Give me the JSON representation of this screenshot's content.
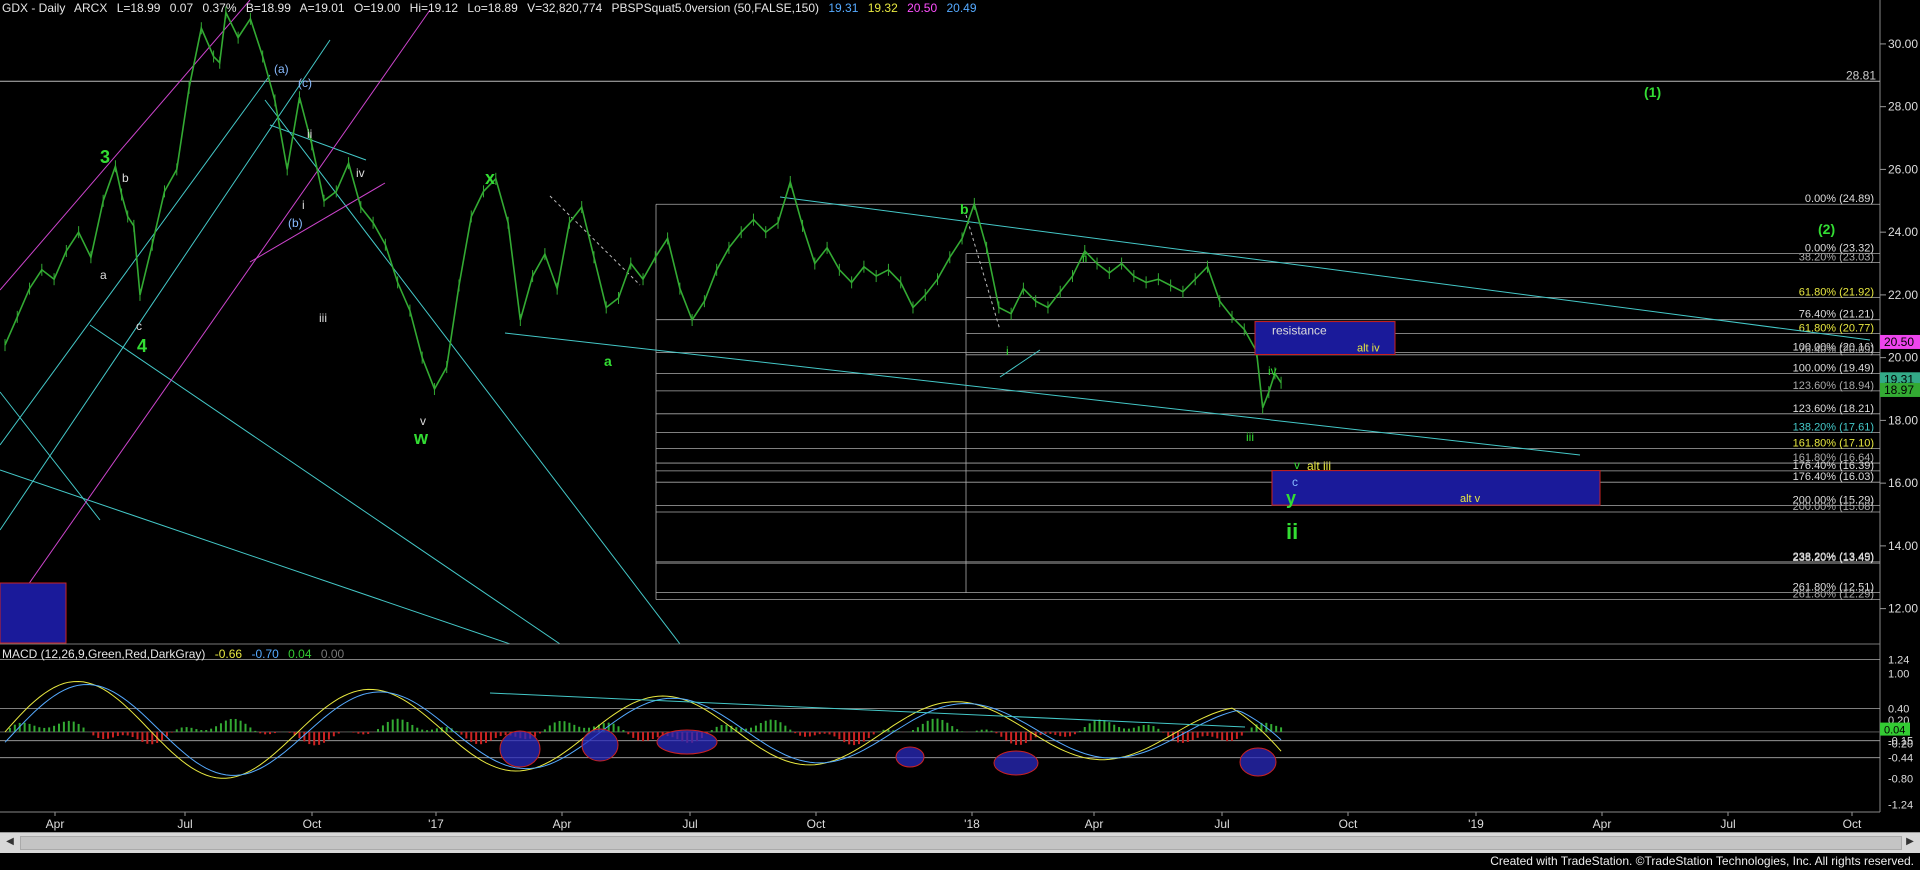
{
  "header": {
    "symbol": "GDX - Daily",
    "exchange": "ARCX",
    "last": "L=18.99",
    "change": "0.07",
    "change_pct": "0.37%",
    "bid": "B=18.99",
    "ask": "A=19.01",
    "open": "O=19.00",
    "high": "Hi=19.12",
    "low": "Lo=18.89",
    "volume": "V=32,820,774",
    "indicator": "PBSPSquat5.0version (50,FALSE,150)",
    "ind_values": [
      "19.31",
      "19.32",
      "20.50",
      "20.49"
    ],
    "ind_colors": [
      "#55aaff",
      "#e8e840",
      "#ff4fff",
      "#55aaff"
    ]
  },
  "macd_header": {
    "label": "MACD (12,26,9,Green,Red,DarkGray)",
    "values": [
      "-0.66",
      "-0.70",
      "0.04",
      "0.00"
    ],
    "colors": [
      "#e8e840",
      "#55aaff",
      "#33cc33",
      "#777777"
    ]
  },
  "footer": "Created with TradeStation. ©TradeStation Technologies, Inc. All rights reserved.",
  "colors": {
    "price": "#33aa33",
    "channel_cyan": "#44c8c8",
    "channel_magenta": "#cc44cc",
    "grid_white": "#bbbbbb",
    "box_fill": "#1a1a9a",
    "box_border": "#cc2222",
    "wave_green": "#33dd33",
    "wave_yellow": "#e8e840",
    "wave_blue": "#88bbff",
    "label_white": "#dddddd"
  },
  "chart_data": {
    "type": "line",
    "title": "GDX - Daily",
    "x_ticks": [
      "Apr",
      "Jul",
      "Oct",
      "'17",
      "Apr",
      "Jul",
      "Oct",
      "'18",
      "Apr",
      "Jul",
      "Oct",
      "'19",
      "Apr",
      "Jul",
      "Oct"
    ],
    "y_ticks": [
      "30.00",
      "28.00",
      "26.00",
      "24.00",
      "22.00",
      "20.00",
      "18.00",
      "16.00",
      "14.00",
      "12.00"
    ],
    "ylim": [
      11,
      31.4
    ],
    "series": [
      {
        "values": [
          [
            0,
            20.4
          ],
          [
            10,
            21.3
          ],
          [
            20,
            22.2
          ],
          [
            30,
            22.8
          ],
          [
            40,
            22.5
          ],
          [
            50,
            23.4
          ],
          [
            60,
            24.0
          ],
          [
            70,
            23.2
          ],
          [
            80,
            25.0
          ],
          [
            90,
            26.1
          ],
          [
            95,
            25.2
          ],
          [
            100,
            24.5
          ],
          [
            105,
            24.2
          ],
          [
            110,
            22.0
          ],
          [
            120,
            23.6
          ],
          [
            130,
            25.3
          ],
          [
            140,
            26.0
          ],
          [
            150,
            28.6
          ],
          [
            160,
            30.5
          ],
          [
            170,
            29.6
          ],
          [
            175,
            29.4
          ],
          [
            180,
            31.0
          ],
          [
            190,
            30.2
          ],
          [
            200,
            30.8
          ],
          [
            210,
            29.6
          ],
          [
            220,
            28.2
          ],
          [
            230,
            26.0
          ],
          [
            240,
            28.3
          ],
          [
            250,
            26.8
          ],
          [
            260,
            25.0
          ],
          [
            270,
            25.3
          ],
          [
            280,
            26.2
          ],
          [
            290,
            24.8
          ],
          [
            300,
            24.3
          ],
          [
            310,
            23.6
          ],
          [
            320,
            22.4
          ],
          [
            330,
            21.5
          ],
          [
            340,
            20.0
          ],
          [
            350,
            19.0
          ],
          [
            360,
            19.7
          ],
          [
            370,
            22.3
          ],
          [
            380,
            24.5
          ],
          [
            390,
            25.3
          ],
          [
            400,
            25.7
          ],
          [
            410,
            24.3
          ],
          [
            420,
            21.2
          ],
          [
            430,
            22.6
          ],
          [
            440,
            23.3
          ],
          [
            450,
            22.2
          ],
          [
            460,
            24.3
          ],
          [
            470,
            24.8
          ],
          [
            480,
            23.2
          ],
          [
            490,
            21.6
          ],
          [
            500,
            21.9
          ],
          [
            510,
            23.0
          ],
          [
            520,
            22.5
          ],
          [
            530,
            23.2
          ],
          [
            540,
            23.8
          ],
          [
            550,
            22.2
          ],
          [
            560,
            21.2
          ],
          [
            570,
            21.8
          ],
          [
            580,
            22.8
          ],
          [
            590,
            23.5
          ],
          [
            600,
            24.0
          ],
          [
            610,
            24.4
          ],
          [
            620,
            24.0
          ],
          [
            630,
            24.3
          ],
          [
            640,
            25.6
          ],
          [
            650,
            24.2
          ],
          [
            660,
            23.0
          ],
          [
            670,
            23.5
          ],
          [
            680,
            22.8
          ],
          [
            690,
            22.4
          ],
          [
            700,
            22.9
          ],
          [
            710,
            22.6
          ],
          [
            720,
            22.8
          ],
          [
            730,
            22.4
          ],
          [
            740,
            21.6
          ],
          [
            750,
            22.0
          ],
          [
            760,
            22.5
          ],
          [
            770,
            23.2
          ],
          [
            780,
            23.8
          ],
          [
            790,
            24.9
          ],
          [
            800,
            23.5
          ],
          [
            810,
            21.6
          ],
          [
            820,
            21.4
          ],
          [
            830,
            22.2
          ],
          [
            840,
            21.8
          ],
          [
            850,
            21.6
          ],
          [
            860,
            22.1
          ],
          [
            870,
            22.6
          ],
          [
            880,
            23.4
          ],
          [
            890,
            23.0
          ],
          [
            900,
            22.7
          ],
          [
            910,
            23.0
          ],
          [
            920,
            22.6
          ],
          [
            930,
            22.4
          ],
          [
            940,
            22.5
          ],
          [
            950,
            22.3
          ],
          [
            960,
            22.1
          ],
          [
            970,
            22.5
          ],
          [
            980,
            22.9
          ],
          [
            990,
            21.8
          ],
          [
            1000,
            21.3
          ],
          [
            1010,
            20.9
          ],
          [
            1020,
            20.2
          ],
          [
            1025,
            18.4
          ],
          [
            1030,
            18.9
          ],
          [
            1035,
            19.5
          ],
          [
            1040,
            19.2
          ]
        ]
      }
    ],
    "price_tags": [
      {
        "value": "28.81",
        "color": "#cccccc"
      },
      {
        "value": "20.50",
        "color": "#ee44ee"
      },
      {
        "value": "19.31",
        "color": "#33aa88"
      },
      {
        "value": "18.97",
        "color": "#33aa33"
      }
    ],
    "fib_levels_left": [
      {
        "text": "0.00% (24.89)"
      },
      {
        "text": "0.00% (23.32)"
      },
      {
        "text": "38.20% (23.03)"
      },
      {
        "text": "61.80% (21.92)"
      },
      {
        "text": "76.40% (21.21)"
      },
      {
        "text": "61.80% (20.77)"
      },
      {
        "text": "100.00% (20.16)"
      },
      {
        "text": "76.40% (20.09)"
      },
      {
        "text": "100.00% (19.49)"
      },
      {
        "text": "123.60% (18.94)"
      },
      {
        "text": "123.60% (18.21)"
      },
      {
        "text": "138.20% (17.61)"
      },
      {
        "text": "161.80% (17.10)"
      },
      {
        "text": "161.80% (16.64)"
      },
      {
        "text": "176.40% (16.39)"
      },
      {
        "text": "176.40% (16.03)"
      },
      {
        "text": "200.00% (15.29)"
      },
      {
        "text": "200.00% (15.08)"
      },
      {
        "text": "238.20% (13.49)"
      },
      {
        "text": "238.20% (13.45)"
      },
      {
        "text": "261.80% (12.51)"
      },
      {
        "text": "261.80% (12.29)"
      }
    ],
    "wave_labels": [
      {
        "text": "3"
      },
      {
        "text": "4"
      },
      {
        "text": "b"
      },
      {
        "text": "a"
      },
      {
        "text": "c"
      },
      {
        "text": "(a)"
      },
      {
        "text": "(c)"
      },
      {
        "text": "(b)"
      },
      {
        "text": "ii"
      },
      {
        "text": "i"
      },
      {
        "text": "iii"
      },
      {
        "text": "iv"
      },
      {
        "text": "v"
      },
      {
        "text": "w"
      },
      {
        "text": "x"
      },
      {
        "text": "a"
      },
      {
        "text": "b"
      },
      {
        "text": "i"
      },
      {
        "text": "ii"
      },
      {
        "text": "iii"
      },
      {
        "text": "iv"
      },
      {
        "text": "v"
      },
      {
        "text": "alt iii"
      },
      {
        "text": "c"
      },
      {
        "text": "y"
      },
      {
        "text": "ii"
      },
      {
        "text": "(1)"
      },
      {
        "text": "(2)"
      }
    ],
    "boxes": [
      {
        "text": "resistance",
        "sub": "alt iv"
      },
      {
        "text": "",
        "sub": "alt v"
      }
    ],
    "macd": {
      "y_ticks": [
        "1.24",
        "1.00",
        "0.40",
        "0.20",
        "-0.15",
        "0.04",
        "-0.20",
        "-0.44",
        "-0.80",
        "-1.24"
      ],
      "ylim": [
        -1.3,
        1.4
      ]
    }
  }
}
